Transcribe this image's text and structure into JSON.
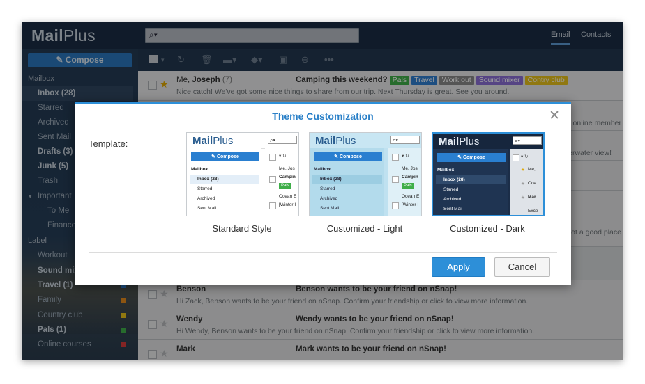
{
  "app": {
    "logo_bold": "Mail",
    "logo_light": "Plus"
  },
  "top_nav": {
    "email": "Email",
    "contacts": "Contacts"
  },
  "search": {
    "icon": "search-icon"
  },
  "sidebar": {
    "compose": "Compose",
    "items": [
      {
        "label": "Mailbox",
        "kind": "section"
      },
      {
        "label": "Inbox (28)",
        "kind": "bold-active"
      },
      {
        "label": "Starred",
        "kind": "normal"
      },
      {
        "label": "Archived",
        "kind": "normal"
      },
      {
        "label": "Sent Mail",
        "kind": "normal"
      },
      {
        "label": "Drafts (3)",
        "kind": "bold"
      },
      {
        "label": "Junk (5)",
        "kind": "bold"
      },
      {
        "label": "Trash",
        "kind": "normal"
      },
      {
        "label": "Important",
        "kind": "folder"
      },
      {
        "label": "To Me",
        "kind": "sub"
      },
      {
        "label": "Finance",
        "kind": "sub"
      },
      {
        "label": "Label",
        "kind": "section"
      },
      {
        "label": "Workout",
        "kind": "normal"
      },
      {
        "label": "Sound mixer",
        "kind": "bold"
      },
      {
        "label": "Travel (1)",
        "kind": "bold",
        "color": "#2f7fd0"
      },
      {
        "label": "Family",
        "kind": "normal",
        "color": "#e48a1c"
      },
      {
        "label": "Country club",
        "kind": "normal",
        "color": "#e8c21a"
      },
      {
        "label": "Pals (1)",
        "kind": "bold",
        "color": "#3fae49"
      },
      {
        "label": "Online courses",
        "kind": "normal",
        "color": "#d63b3b"
      }
    ]
  },
  "messages": [
    {
      "from": "Me, ",
      "from_bold": "Joseph",
      "count": "(7)",
      "subject": "Camping this weekend?",
      "preview": "Nice catch! We've got some nice things to share from our trip. Next Thursday is great. See you around.",
      "tags": [
        {
          "label": "Pals",
          "color": "#3fae49"
        },
        {
          "label": "Travel",
          "color": "#2f7fd0"
        },
        {
          "label": "Work out",
          "color": "#8a8a8a"
        },
        {
          "label": "Sound mixer",
          "color": "#8b6fd6"
        },
        {
          "label": "Contry club",
          "color": "#e8c21a"
        }
      ],
      "starred": true
    },
    {
      "from_bold": "Benson",
      "subject": "Benson wants to be your friend on nSnap!",
      "preview": "Hi Zack, Benson wants to be your friend on nSnap. Confirm your friendship or click to view more information."
    },
    {
      "from_bold": "Wendy",
      "subject": "Wendy wants to be your friend on nSnap!",
      "preview": "Hi Wendy, Benson wants to be your friend on nSnap. Confirm your friendship or click to view more information."
    },
    {
      "from_bold": "Mark",
      "subject": "Mark wants to be your friend on nSnap!",
      "preview": ""
    }
  ],
  "partial_right": {
    "r1": "r online member",
    "r2": "erwater view!",
    "r3": "got a good place"
  },
  "dialog": {
    "title": "Theme Customization",
    "template_label": "Template:",
    "options": [
      {
        "caption": "Standard Style",
        "variant": "standard"
      },
      {
        "caption": "Customized - Light",
        "variant": "light"
      },
      {
        "caption": "Customized - Dark",
        "variant": "dark",
        "selected": true
      }
    ],
    "apply": "Apply",
    "cancel": "Cancel"
  },
  "mini": {
    "logo_bold": "Mail",
    "logo_light": "Plus",
    "search": "⌕▾",
    "compose": "Compose",
    "mailbox": "Mailbox",
    "items": [
      "Inbox (28)",
      "Starred",
      "Archived",
      "Sent Mail"
    ],
    "m1": "Me, Jos",
    "m2": "Campin",
    "tag": "Pals",
    "m3": "Ocean E",
    "m4": "[Winter I",
    "d1": "Me,",
    "d2": "Oce",
    "d3": "Mar",
    "d4": "Exce"
  }
}
